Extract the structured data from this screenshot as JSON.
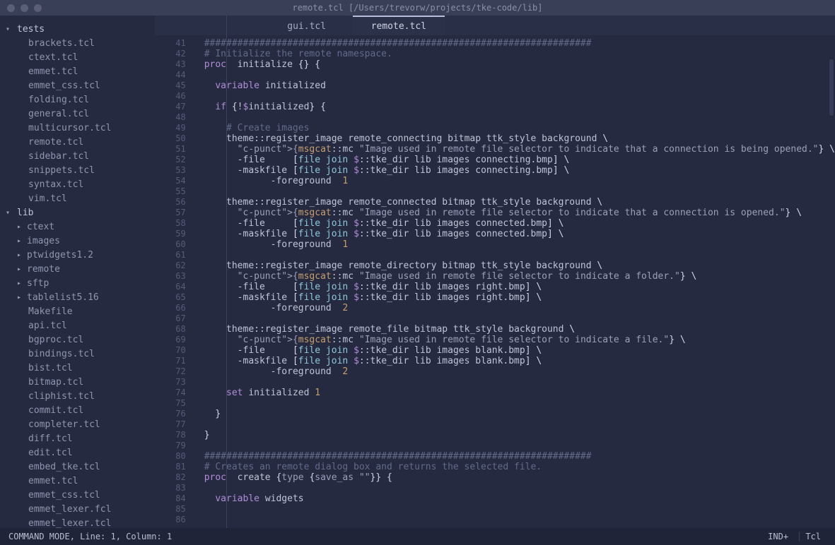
{
  "title": "remote.tcl [/Users/trevorw/projects/tke-code/lib]",
  "sidebar": {
    "roots": [
      {
        "name": "tests",
        "expanded": true,
        "items": [
          {
            "label": "brackets.tcl",
            "type": "file"
          },
          {
            "label": "ctext.tcl",
            "type": "file"
          },
          {
            "label": "emmet.tcl",
            "type": "file"
          },
          {
            "label": "emmet_css.tcl",
            "type": "file"
          },
          {
            "label": "folding.tcl",
            "type": "file"
          },
          {
            "label": "general.tcl",
            "type": "file"
          },
          {
            "label": "multicursor.tcl",
            "type": "file"
          },
          {
            "label": "remote.tcl",
            "type": "file"
          },
          {
            "label": "sidebar.tcl",
            "type": "file"
          },
          {
            "label": "snippets.tcl",
            "type": "file"
          },
          {
            "label": "syntax.tcl",
            "type": "file"
          },
          {
            "label": "vim.tcl",
            "type": "file"
          }
        ]
      },
      {
        "name": "lib",
        "expanded": true,
        "items": [
          {
            "label": "ctext",
            "type": "folder"
          },
          {
            "label": "images",
            "type": "folder"
          },
          {
            "label": "ptwidgets1.2",
            "type": "folder"
          },
          {
            "label": "remote",
            "type": "folder"
          },
          {
            "label": "sftp",
            "type": "folder"
          },
          {
            "label": "tablelist5.16",
            "type": "folder"
          },
          {
            "label": "Makefile",
            "type": "file"
          },
          {
            "label": "api.tcl",
            "type": "file"
          },
          {
            "label": "bgproc.tcl",
            "type": "file"
          },
          {
            "label": "bindings.tcl",
            "type": "file"
          },
          {
            "label": "bist.tcl",
            "type": "file"
          },
          {
            "label": "bitmap.tcl",
            "type": "file"
          },
          {
            "label": "cliphist.tcl",
            "type": "file"
          },
          {
            "label": "commit.tcl",
            "type": "file"
          },
          {
            "label": "completer.tcl",
            "type": "file"
          },
          {
            "label": "diff.tcl",
            "type": "file"
          },
          {
            "label": "edit.tcl",
            "type": "file"
          },
          {
            "label": "embed_tke.tcl",
            "type": "file"
          },
          {
            "label": "emmet.tcl",
            "type": "file"
          },
          {
            "label": "emmet_css.tcl",
            "type": "file"
          },
          {
            "label": "emmet_lexer.fcl",
            "type": "file"
          },
          {
            "label": "emmet_lexer.tcl",
            "type": "file"
          }
        ]
      }
    ]
  },
  "tabs": [
    {
      "label": "gui.tcl",
      "active": false
    },
    {
      "label": "remote.tcl",
      "active": true
    }
  ],
  "editor": {
    "first_line": 41,
    "lines_count": 46,
    "lines": [
      {
        "n": 41,
        "t": "comment",
        "txt": "######################################################################"
      },
      {
        "n": 42,
        "t": "comment",
        "txt": "# Initialize the remote namespace."
      },
      {
        "n": 43,
        "t": "proc",
        "txt": "proc initialize {} {"
      },
      {
        "n": 44,
        "t": "blank",
        "txt": ""
      },
      {
        "n": 45,
        "t": "var",
        "txt": "  variable initialized"
      },
      {
        "n": 46,
        "t": "blank",
        "txt": ""
      },
      {
        "n": 47,
        "t": "if",
        "txt": "  if {!$initialized} {"
      },
      {
        "n": 48,
        "t": "blank",
        "txt": ""
      },
      {
        "n": 49,
        "t": "comment2",
        "txt": "    # Create images"
      },
      {
        "n": 50,
        "t": "call",
        "txt": "    theme::register_image remote_connecting bitmap ttk_style background \\"
      },
      {
        "n": 51,
        "t": "msg",
        "txt": "      {msgcat::mc \"Image used in remote file selector to indicate that a connection is being opened.\"} \\"
      },
      {
        "n": 52,
        "t": "file",
        "txt": "      -file     [file join $::tke_dir lib images connecting.bmp] \\"
      },
      {
        "n": 53,
        "t": "file",
        "txt": "      -maskfile [file join $::tke_dir lib images connecting.bmp] \\"
      },
      {
        "n": 54,
        "t": "fg",
        "txt": "      -foreground 1"
      },
      {
        "n": 55,
        "t": "blank",
        "txt": ""
      },
      {
        "n": 56,
        "t": "call",
        "txt": "    theme::register_image remote_connected bitmap ttk_style background \\"
      },
      {
        "n": 57,
        "t": "msg",
        "txt": "      {msgcat::mc \"Image used in remote file selector to indicate that a connection is opened.\"} \\"
      },
      {
        "n": 58,
        "t": "file",
        "txt": "      -file     [file join $::tke_dir lib images connected.bmp] \\"
      },
      {
        "n": 59,
        "t": "file",
        "txt": "      -maskfile [file join $::tke_dir lib images connected.bmp] \\"
      },
      {
        "n": 60,
        "t": "fg",
        "txt": "      -foreground 1"
      },
      {
        "n": 61,
        "t": "blank",
        "txt": ""
      },
      {
        "n": 62,
        "t": "call",
        "txt": "    theme::register_image remote_directory bitmap ttk_style background \\"
      },
      {
        "n": 63,
        "t": "msg",
        "txt": "      {msgcat::mc \"Image used in remote file selector to indicate a folder.\"} \\"
      },
      {
        "n": 64,
        "t": "file",
        "txt": "      -file     [file join $::tke_dir lib images right.bmp] \\"
      },
      {
        "n": 65,
        "t": "file",
        "txt": "      -maskfile [file join $::tke_dir lib images right.bmp] \\"
      },
      {
        "n": 66,
        "t": "fg",
        "txt": "      -foreground 2"
      },
      {
        "n": 67,
        "t": "blank",
        "txt": ""
      },
      {
        "n": 68,
        "t": "call",
        "txt": "    theme::register_image remote_file bitmap ttk_style background \\"
      },
      {
        "n": 69,
        "t": "msg",
        "txt": "      {msgcat::mc \"Image used in remote file selector to indicate a file.\"} \\"
      },
      {
        "n": 70,
        "t": "file",
        "txt": "      -file     [file join $::tke_dir lib images blank.bmp] \\"
      },
      {
        "n": 71,
        "t": "file",
        "txt": "      -maskfile [file join $::tke_dir lib images blank.bmp] \\"
      },
      {
        "n": 72,
        "t": "fg",
        "txt": "      -foreground 2"
      },
      {
        "n": 73,
        "t": "blank",
        "txt": ""
      },
      {
        "n": 74,
        "t": "set",
        "txt": "    set initialized 1"
      },
      {
        "n": 75,
        "t": "blank",
        "txt": ""
      },
      {
        "n": 76,
        "t": "brace",
        "txt": "  }"
      },
      {
        "n": 77,
        "t": "blank",
        "txt": ""
      },
      {
        "n": 78,
        "t": "brace",
        "txt": "}"
      },
      {
        "n": 79,
        "t": "blank",
        "txt": ""
      },
      {
        "n": 80,
        "t": "comment",
        "txt": "######################################################################"
      },
      {
        "n": 81,
        "t": "comment",
        "txt": "# Creates an remote dialog box and returns the selected file."
      },
      {
        "n": 82,
        "t": "proc",
        "txt": "proc create {type {save_as \"\"}} {"
      },
      {
        "n": 83,
        "t": "blank",
        "txt": ""
      },
      {
        "n": 84,
        "t": "var",
        "txt": "  variable widgets"
      },
      {
        "n": 85,
        "t": "blank",
        "txt": ""
      },
      {
        "n": 86,
        "t": "blank",
        "txt": ""
      }
    ]
  },
  "status": {
    "left": "COMMAND MODE, Line: 1, Column: 1",
    "indent": "IND+",
    "lang": "Tcl"
  }
}
